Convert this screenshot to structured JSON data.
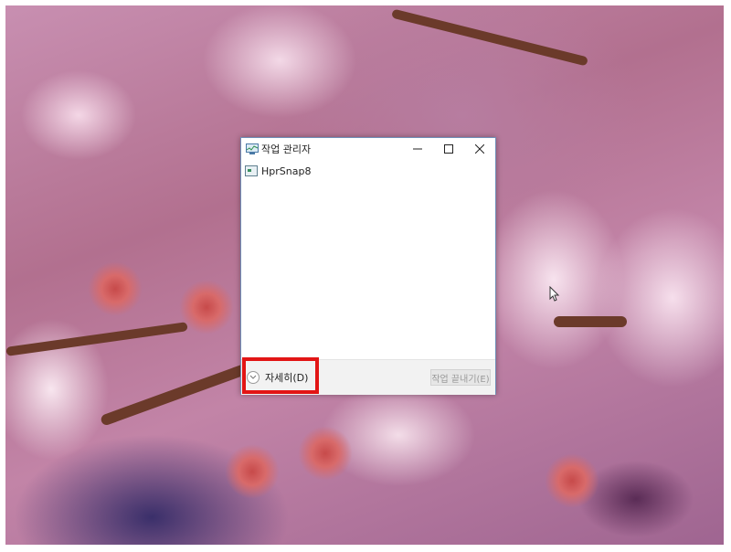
{
  "window": {
    "title": "작업 관리자",
    "controls": {
      "minimize": "minimize",
      "maximize": "maximize",
      "close": "close"
    }
  },
  "process_list": [
    {
      "name": "HprSnap8",
      "icon": "application-icon"
    }
  ],
  "footer": {
    "details_label": "자세히(D)",
    "end_task_label": "작업 끝내기(E)",
    "end_task_enabled": false
  },
  "annotation": {
    "highlight_color": "#e21515"
  }
}
